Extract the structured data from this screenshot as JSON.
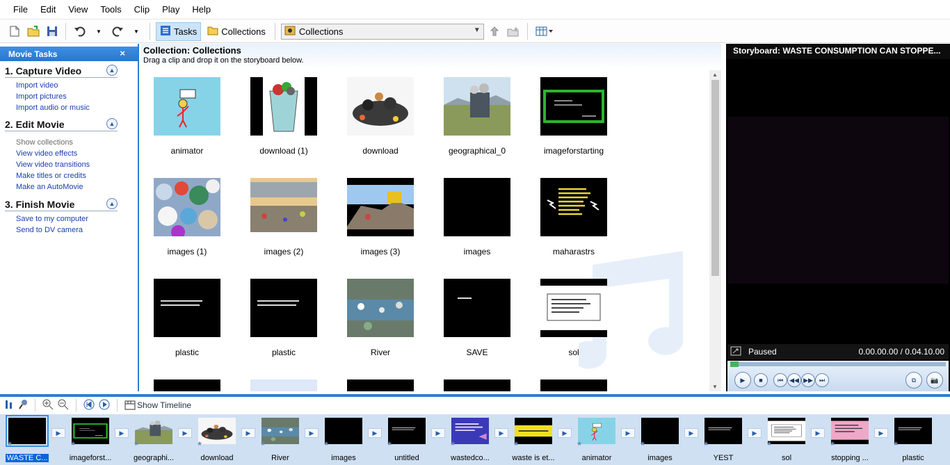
{
  "menu": [
    "File",
    "Edit",
    "View",
    "Tools",
    "Clip",
    "Play",
    "Help"
  ],
  "toolbar": {
    "tasks_label": "Tasks",
    "collections_label": "Collections",
    "combo_value": "Collections"
  },
  "tasks_pane": {
    "title": "Movie Tasks",
    "close": "×",
    "sections": [
      {
        "title": "1. Capture Video",
        "links": [
          "Import video",
          "Import pictures",
          "Import audio or music"
        ]
      },
      {
        "title": "2. Edit Movie",
        "links": [
          "Show collections",
          "View video effects",
          "View video transitions",
          "Make titles or credits",
          "Make an AutoMovie"
        ]
      },
      {
        "title": "3. Finish Movie",
        "links": [
          "Save to my computer",
          "Send to DV camera"
        ]
      }
    ]
  },
  "collection": {
    "title": "Collection: Collections",
    "subtitle": "Drag a clip and drop it on the storyboard below.",
    "clips": [
      {
        "label": "animator",
        "thumb": "animator"
      },
      {
        "label": "download (1)",
        "thumb": "bin"
      },
      {
        "label": "download",
        "thumb": "trashpile"
      },
      {
        "label": "geographical_0",
        "thumb": "landscape"
      },
      {
        "label": "imageforstarting",
        "thumb": "greenbox"
      },
      {
        "label": "images (1)",
        "thumb": "bottles"
      },
      {
        "label": "images (2)",
        "thumb": "landfill"
      },
      {
        "label": "images (3)",
        "thumb": "dozer"
      },
      {
        "label": "images",
        "thumb": "black"
      },
      {
        "label": "maharastrs",
        "thumb": "yellowtext"
      },
      {
        "label": "plastic",
        "thumb": "text"
      },
      {
        "label": "plastic",
        "thumb": "text"
      },
      {
        "label": "River",
        "thumb": "river"
      },
      {
        "label": "SAVE",
        "thumb": "textsmall"
      },
      {
        "label": "sol",
        "thumb": "whitebox"
      }
    ]
  },
  "monitor": {
    "title": "Storyboard: WASTE CONSUMPTION CAN STOPPE...",
    "status": "Paused",
    "time": "0.00.00.00 / 0.04.10.00",
    "progress": 0
  },
  "storyboard_toolbar": {
    "show_timeline": "Show Timeline"
  },
  "storyboard": [
    {
      "label": "WASTE C...",
      "thumb": "black"
    },
    {
      "label": "imageforst...",
      "thumb": "greenbox"
    },
    {
      "label": "geographi...",
      "thumb": "landscape"
    },
    {
      "label": "download",
      "thumb": "trashpile"
    },
    {
      "label": "River",
      "thumb": "river"
    },
    {
      "label": "images",
      "thumb": "black"
    },
    {
      "label": "untitled",
      "thumb": "text"
    },
    {
      "label": "wastedco...",
      "thumb": "bluepurple"
    },
    {
      "label": "waste is et...",
      "thumb": "yellowband"
    },
    {
      "label": "animator",
      "thumb": "animator"
    },
    {
      "label": "images",
      "thumb": "black"
    },
    {
      "label": "YEST",
      "thumb": "text"
    },
    {
      "label": "sol",
      "thumb": "whitebox"
    },
    {
      "label": "stopping ...",
      "thumb": "pink"
    },
    {
      "label": "plastic",
      "thumb": "text"
    }
  ]
}
